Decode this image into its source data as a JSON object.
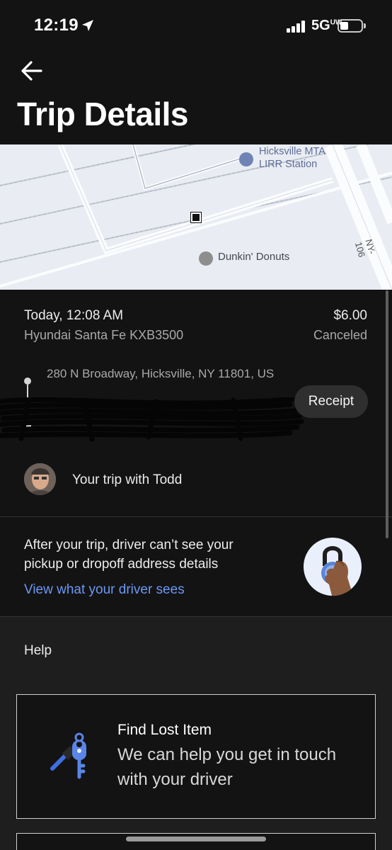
{
  "status_bar": {
    "time": "12:19",
    "network": "5G",
    "network_suffix": "UW"
  },
  "header": {
    "title": "Trip Details"
  },
  "map": {
    "poi_station": "Hicksville MTA\nLIRR Station",
    "poi_dunkin": "Dunkin' Donuts",
    "road_label": "NY-106"
  },
  "trip": {
    "date": "Today, 12:08 AM",
    "price": "$6.00",
    "vehicle": "Hyundai Santa Fe KXB3500",
    "status": "Canceled",
    "pickup_address": "280 N Broadway, Hicksville, NY 11801, US",
    "receipt_label": "Receipt",
    "driver_text": "Your trip with Todd"
  },
  "privacy": {
    "text": "After your trip, driver can’t see your pickup or dropoff address details",
    "link": "View what your driver sees"
  },
  "help": {
    "title": "Help",
    "lost_item_title": "Find Lost Item",
    "lost_item_desc": "We can help you get in touch with your driver"
  },
  "colors": {
    "background": "#131313",
    "link": "#6d97f5",
    "map": "#e9ecf2"
  }
}
